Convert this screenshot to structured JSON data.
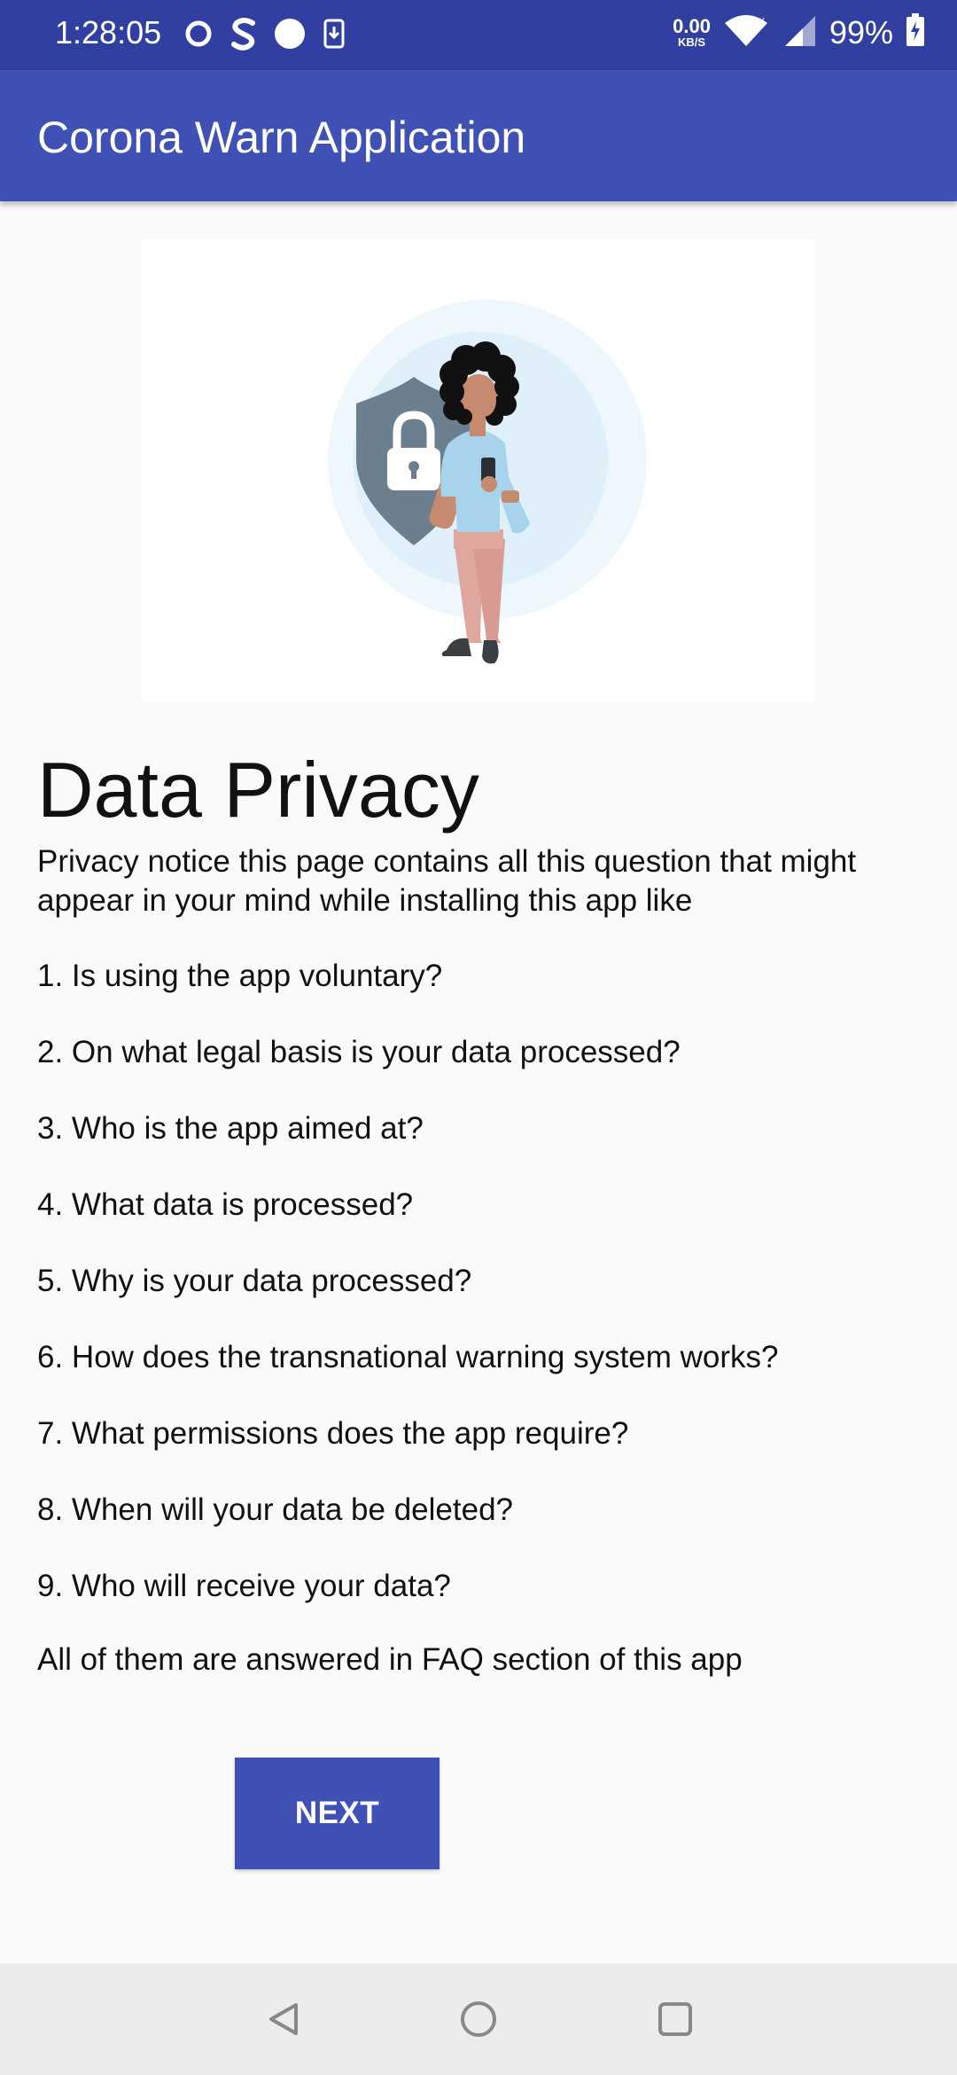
{
  "status_bar": {
    "time": "1:28:05",
    "network_speed_value": "0.00",
    "network_speed_unit": "KB/S",
    "battery_percent": "99%",
    "icons": [
      "sync-icon",
      "s-app-icon",
      "circle-notification-icon",
      "download-icon",
      "wifi-icon",
      "cell-signal-icon",
      "battery-charging-icon"
    ]
  },
  "app_bar": {
    "title": "Corona Warn Application"
  },
  "content": {
    "heading": "Data Privacy",
    "intro": "Privacy notice this page contains all this question that might appear in your mind while installing this app like",
    "questions": [
      "1. Is using the app voluntary?",
      "2. On what legal basis is your data processed?",
      "3. Who is the app aimed at?",
      "4. What data is processed?",
      "5. Why is your data processed?",
      "6. How does the transnational warning system works?",
      "7. What permissions does the app require?",
      "8. When will your data be deleted?",
      "9. Who will receive your data?"
    ],
    "outro": "All of them are answered in FAQ section of this app",
    "next_label": "NEXT"
  },
  "nav_bar": {
    "icons": [
      "back-icon",
      "home-icon",
      "recents-icon"
    ]
  },
  "colors": {
    "status_bar": "#3140a0",
    "primary": "#3f51b5",
    "background": "#fafafa",
    "nav_bar": "#ececec"
  }
}
